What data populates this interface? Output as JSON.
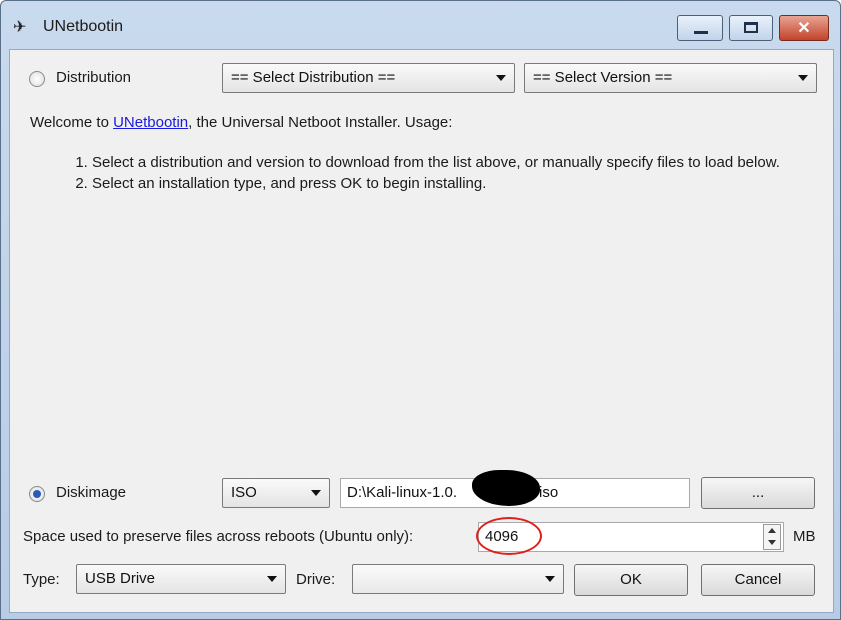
{
  "window": {
    "title": "UNetbootin",
    "minimize_glyph": "",
    "maximize_glyph": "",
    "close_glyph": "✕"
  },
  "distribution": {
    "label": "Distribution",
    "distribution_select": "== Select Distribution ==",
    "version_select": "== Select Version =="
  },
  "description": {
    "welcome_prefix": "Welcome to ",
    "welcome_link": "UNetbootin",
    "welcome_suffix": ", the Universal Netboot Installer. Usage:",
    "steps": [
      "Select a distribution and version to download from the list above, or manually specify files to load below.",
      "Select an installation type, and press OK to begin installing."
    ]
  },
  "diskimage": {
    "label": "Diskimage",
    "type_select": "ISO",
    "path_value": "D:\\Kali-linux-1.0.",
    "path_suffix": "iso",
    "browse_label": "..."
  },
  "persistence": {
    "label": "Space used to preserve files across reboots (Ubuntu only):",
    "value": "4096",
    "unit": "MB"
  },
  "bottom": {
    "type_label": "Type:",
    "type_value": "USB Drive",
    "drive_label": "Drive:",
    "drive_value": "",
    "ok_label": "OK",
    "cancel_label": "Cancel"
  },
  "colors": {
    "title_gradient_top": "#c9daee",
    "close_button": "#c2442b",
    "link": "#1a1adc",
    "annotation_red": "#e0201c"
  }
}
